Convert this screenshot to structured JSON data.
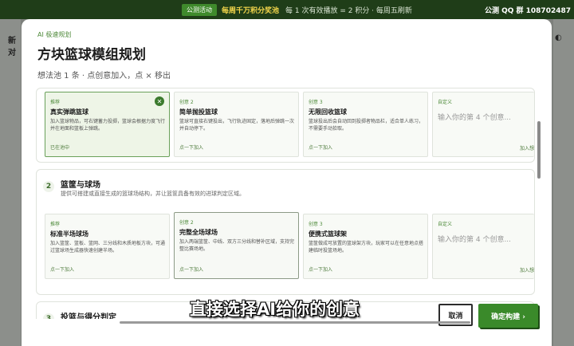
{
  "topbar": {
    "event_pill": "公测活动",
    "promo": "每周千万积分奖池",
    "info": "每 1 次有效播放 = 2 积分 · 每周五刷新",
    "qq": "公测 QQ 群 108702487"
  },
  "background": {
    "left_label": "新对",
    "right_label": "◐"
  },
  "dialog": {
    "eyebrow": "AI 极速规划",
    "title": "方块篮球模组规划",
    "subtitle": "想法池 1 条 · 点创意加入，点 × 移出"
  },
  "sections": [
    {
      "num": "",
      "title": "",
      "desc": "",
      "cards": [
        {
          "tag": "推荐",
          "name": "真实弹跳篮球",
          "desc": "加入篮球物品，可右键蓄力投掷，篮球会根据力度飞行并在地面和篮板上弹跳。",
          "foot": "已在池中",
          "selected": true
        },
        {
          "tag": "创意 2",
          "name": "简单抛投篮球",
          "desc": "篮球可直接右键投出，飞行轨迹固定，落地后弹跳一次并自动停下。",
          "foot": "点一下加入"
        },
        {
          "tag": "创意 3",
          "name": "无限回收篮球",
          "desc": "篮球投出后会自动回到投掷者物品栏，适合单人练习，不需要手动拾取。",
          "foot": "点一下加入"
        },
        {
          "tag": "自定义",
          "placeholder": "输入你的第 4 个创意...",
          "add": "加入想"
        }
      ]
    },
    {
      "num": "2",
      "title": "篮筐与球场",
      "desc": "提供可搭建或直接生成的篮球场结构，并让篮筐具备有效的进球判定区域。",
      "cards": [
        {
          "tag": "推荐",
          "name": "标准半场球场",
          "desc": "加入篮筐、篮板、篮网、三分线和木质地板方块，可通过篮球场生成器快速创建半场。",
          "foot": "点一下加入"
        },
        {
          "tag": "创意 2",
          "name": "完整全场球场",
          "desc": "加入两端篮筐、中线、双方三分线和替补区域，支持完整比赛场地。",
          "foot": "点一下加入",
          "outlined": true
        },
        {
          "tag": "创意 3",
          "name": "便携式篮球架",
          "desc": "篮筐做成可放置的篮球架方块，玩家可以在任意地点搭建临时投篮场地。",
          "foot": "点一下加入"
        },
        {
          "tag": "自定义",
          "placeholder": "输入你的第 4 个创意...",
          "add": "加入想"
        }
      ]
    },
    {
      "num": "3",
      "title": "投篮与得分判定"
    }
  ],
  "buttons": {
    "cancel": "取消",
    "confirm": "确定构建 ›"
  },
  "caption": "直接选择AI给你的创意"
}
